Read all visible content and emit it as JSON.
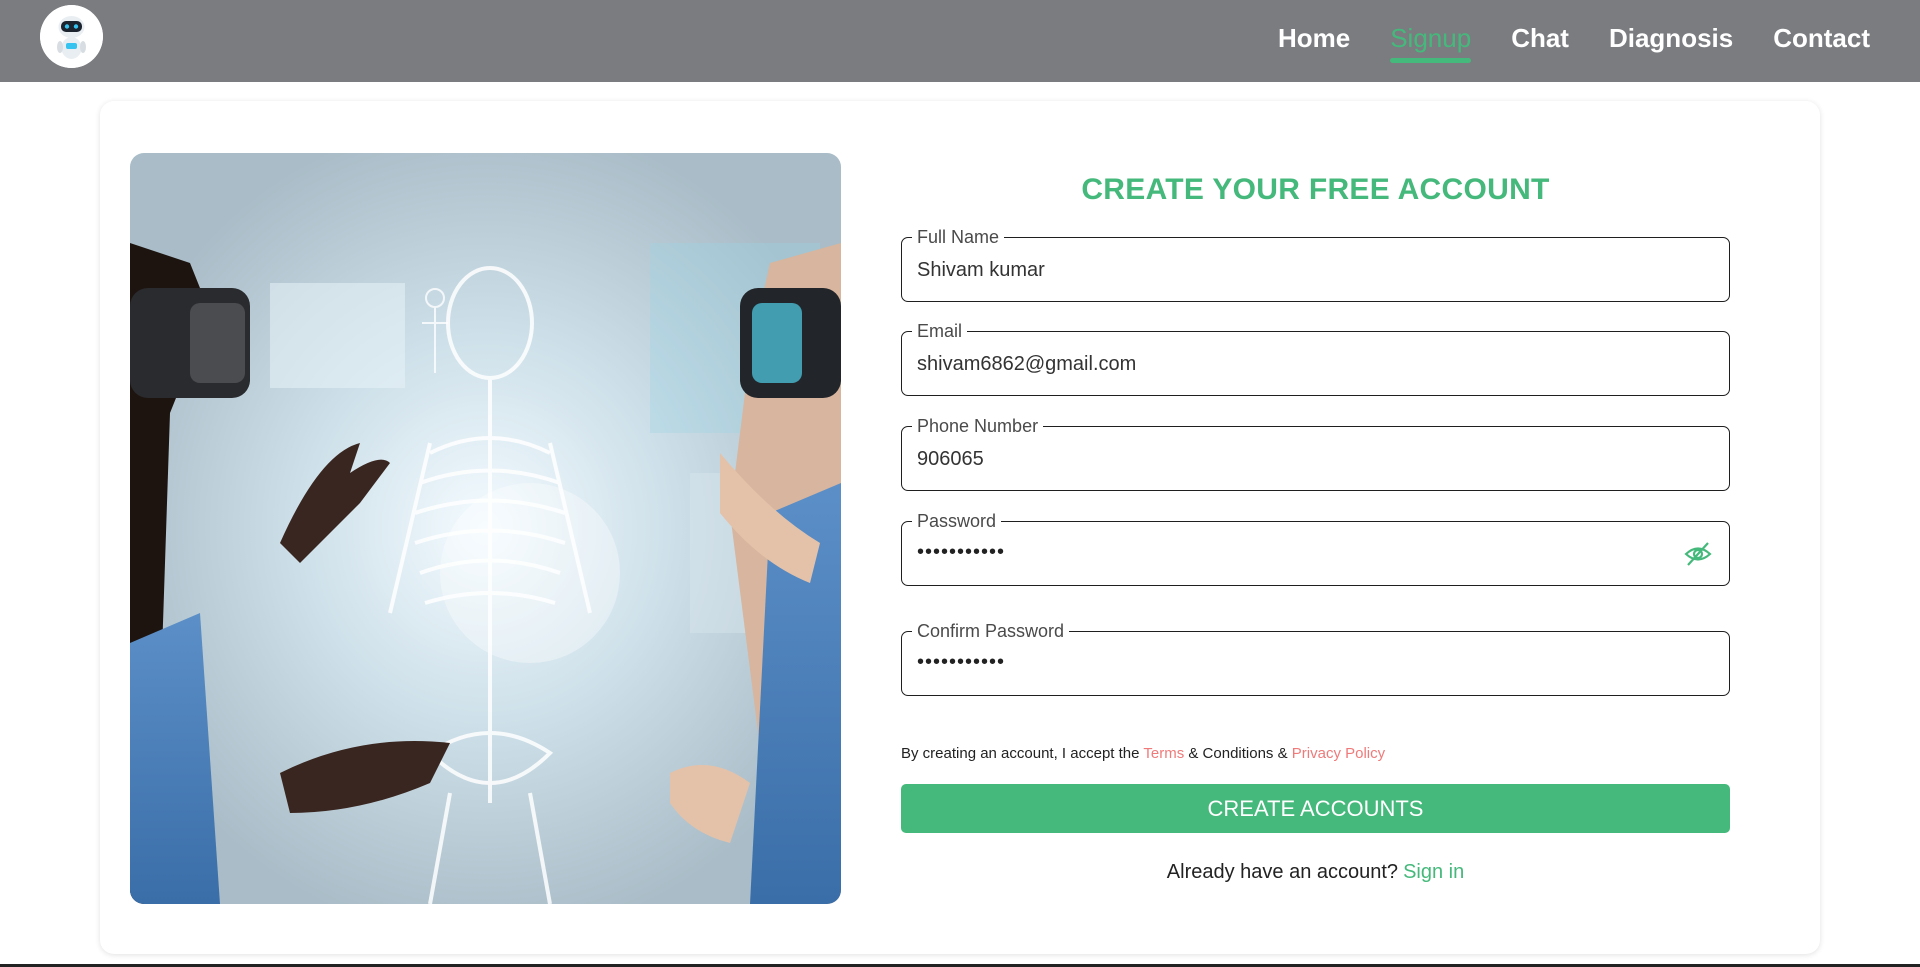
{
  "nav": {
    "logo_icon": "robot-avatar-icon",
    "items": [
      {
        "label": "Home",
        "active": false
      },
      {
        "label": "Signup",
        "active": true
      },
      {
        "label": "Chat",
        "active": false
      },
      {
        "label": "Diagnosis",
        "active": false
      },
      {
        "label": "Contact",
        "active": false
      }
    ]
  },
  "hero": {
    "icon": "skeleton-hologram-image"
  },
  "form": {
    "title": "CREATE YOUR FREE ACCOUNT",
    "fields": [
      {
        "label": "Full Name",
        "value": "Shivam kumar"
      },
      {
        "label": "Email",
        "value": "shivam6862@gmail.com"
      },
      {
        "label": "Phone Number",
        "value": "906065"
      },
      {
        "label": "Password",
        "value": "•••••••••••"
      },
      {
        "label": "Confirm Password",
        "value": "•••••••••••"
      }
    ],
    "password_toggle_icon": "eye-off-icon",
    "terms": {
      "prefix": "By creating an account, I accept the ",
      "terms_link": "Terms",
      "middle": " & Conditions & ",
      "privacy_link": "Privacy Policy"
    },
    "submit_label": "CREATE ACCOUNTS",
    "signin_prompt": "Already have an account?",
    "signin_label": "Sign in"
  },
  "colors": {
    "navbar_bg": "#7a7c80",
    "accent": "#45b97b",
    "link_red": "#f07a7a"
  }
}
